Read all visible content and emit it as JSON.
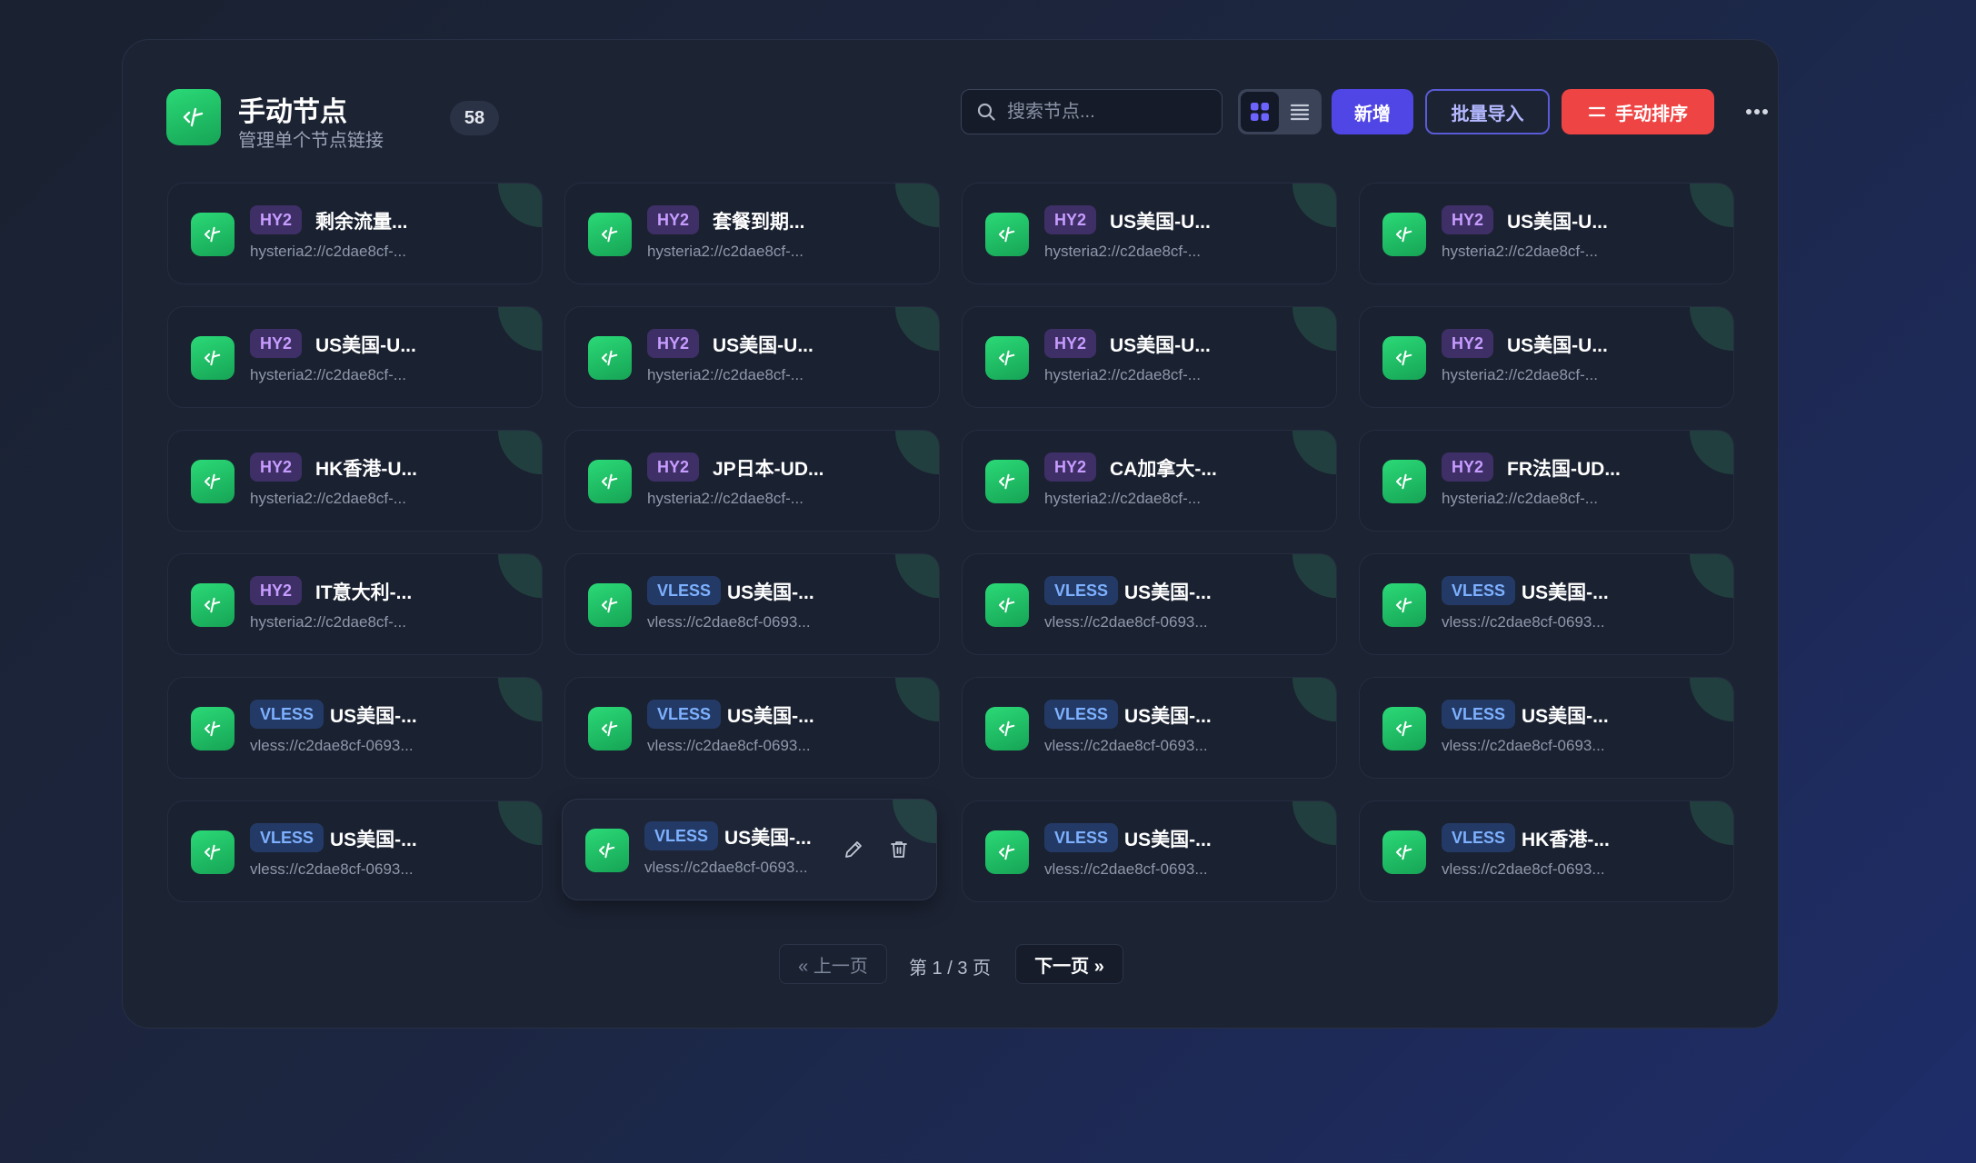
{
  "header": {
    "title": "手动节点",
    "subtitle": "管理单个节点链接",
    "count": "58",
    "search_placeholder": "搜索节点...",
    "new_label": "新增",
    "import_label": "批量导入",
    "sort_label": "手动排序",
    "view_mode": "grid"
  },
  "colors": {
    "accent": "#5046e5",
    "danger": "#ef4444",
    "node_icon": "#22c56a",
    "hy2_tag": "#c79cff",
    "vless_tag": "#7db1ff"
  },
  "nodes": [
    {
      "type": "HY2",
      "name": "剩余流量...",
      "url": "hysteria2://c2dae8cf-..."
    },
    {
      "type": "HY2",
      "name": "套餐到期...",
      "url": "hysteria2://c2dae8cf-..."
    },
    {
      "type": "HY2",
      "name": "US美国-U...",
      "url": "hysteria2://c2dae8cf-..."
    },
    {
      "type": "HY2",
      "name": "US美国-U...",
      "url": "hysteria2://c2dae8cf-..."
    },
    {
      "type": "HY2",
      "name": "US美国-U...",
      "url": "hysteria2://c2dae8cf-..."
    },
    {
      "type": "HY2",
      "name": "US美国-U...",
      "url": "hysteria2://c2dae8cf-..."
    },
    {
      "type": "HY2",
      "name": "US美国-U...",
      "url": "hysteria2://c2dae8cf-..."
    },
    {
      "type": "HY2",
      "name": "US美国-U...",
      "url": "hysteria2://c2dae8cf-..."
    },
    {
      "type": "HY2",
      "name": "HK香港-U...",
      "url": "hysteria2://c2dae8cf-..."
    },
    {
      "type": "HY2",
      "name": "JP日本-UD...",
      "url": "hysteria2://c2dae8cf-..."
    },
    {
      "type": "HY2",
      "name": "CA加拿大-...",
      "url": "hysteria2://c2dae8cf-..."
    },
    {
      "type": "HY2",
      "name": "FR法国-UD...",
      "url": "hysteria2://c2dae8cf-..."
    },
    {
      "type": "HY2",
      "name": "IT意大利-...",
      "url": "hysteria2://c2dae8cf-..."
    },
    {
      "type": "VLESS",
      "name": "US美国-...",
      "url": "vless://c2dae8cf-0693..."
    },
    {
      "type": "VLESS",
      "name": "US美国-...",
      "url": "vless://c2dae8cf-0693..."
    },
    {
      "type": "VLESS",
      "name": "US美国-...",
      "url": "vless://c2dae8cf-0693..."
    },
    {
      "type": "VLESS",
      "name": "US美国-...",
      "url": "vless://c2dae8cf-0693..."
    },
    {
      "type": "VLESS",
      "name": "US美国-...",
      "url": "vless://c2dae8cf-0693..."
    },
    {
      "type": "VLESS",
      "name": "US美国-...",
      "url": "vless://c2dae8cf-0693..."
    },
    {
      "type": "VLESS",
      "name": "US美国-...",
      "url": "vless://c2dae8cf-0693..."
    },
    {
      "type": "VLESS",
      "name": "US美国-...",
      "url": "vless://c2dae8cf-0693..."
    },
    {
      "type": "VLESS",
      "name": "US美国-...",
      "url": "vless://c2dae8cf-0693...",
      "hovered": true
    },
    {
      "type": "VLESS",
      "name": "US美国-...",
      "url": "vless://c2dae8cf-0693..."
    },
    {
      "type": "VLESS",
      "name": "HK香港-...",
      "url": "vless://c2dae8cf-0693..."
    }
  ],
  "pagination": {
    "prev_label": "« 上一页",
    "info": "第 1 / 3 页",
    "next_label": "下一页 »"
  }
}
